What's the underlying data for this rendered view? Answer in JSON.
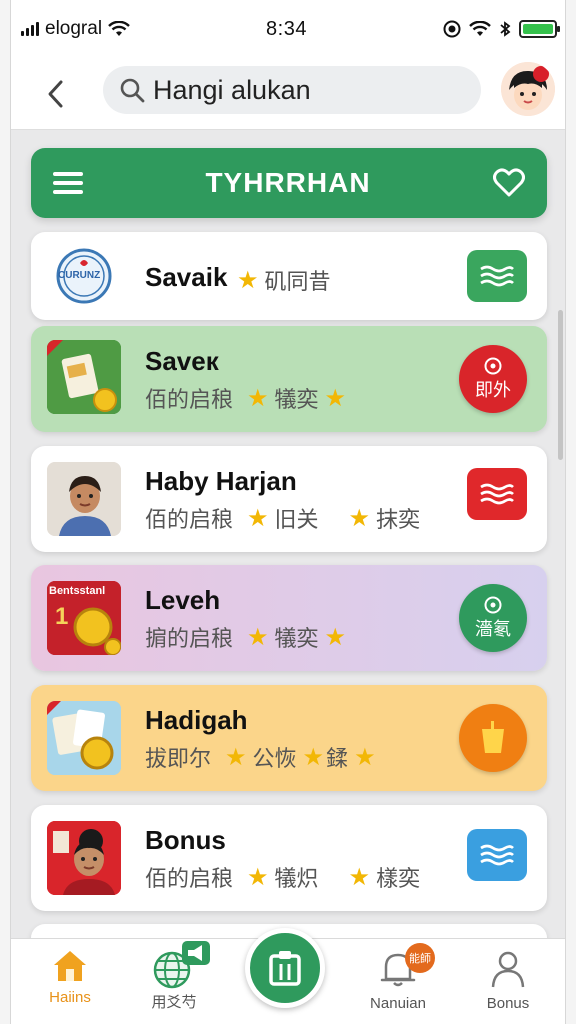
{
  "status": {
    "carrier": "elogral",
    "time": "8:34"
  },
  "header": {
    "search_text": "Hangi alukan"
  },
  "banner": {
    "title": "TYHRRHAN"
  },
  "items": [
    {
      "title": "Savaik",
      "tags": [
        "矶同昔"
      ],
      "card_color": "#ffffff",
      "button_color": "#3aa65e",
      "button_type": "waves-icon"
    },
    {
      "title": "Saveк",
      "subtitle": "佰的启稂",
      "tags": [
        "犠奕"
      ],
      "card_color": "#b9dfb6",
      "button_color": "#d9252a",
      "button_label": "即外",
      "button_type": "target-icon"
    },
    {
      "title": "Haby Harjan",
      "subtitle": "佰的启稂",
      "tags": [
        "旧关",
        "抹奕"
      ],
      "card_color": "#ffffff",
      "button_color": "#e0282b",
      "button_type": "waves-icon"
    },
    {
      "title": "Leveh",
      "subtitle": "掮的启稂",
      "tags": [
        "犠奕"
      ],
      "card_color": "#e3c9e4",
      "button_color": "#2f9a5d",
      "button_label": "濇氡",
      "button_type": "target-icon"
    },
    {
      "title": "Hadigah",
      "subtitle": "拔即尔",
      "tags": [
        "公恢",
        "鍒"
      ],
      "card_color": "#fbd58a",
      "button_color": "#f07f12",
      "button_type": "cup-icon"
    },
    {
      "title": "Bonus",
      "subtitle": "佰的启稂",
      "tags": [
        "犠炽",
        "樣奕"
      ],
      "card_color": "#ffffff",
      "button_color": "#3a9fe0",
      "button_type": "waves-icon"
    }
  ],
  "thumb_texts": {
    "item1_logo": "CURUNZ",
    "item4_logo": "Bentsstanl",
    "item4_num": "1"
  },
  "nav": {
    "home": "Haiins",
    "explore": "用爻芍",
    "badge": "能師",
    "notifications": "Nanuian",
    "profile": "Bonus"
  }
}
